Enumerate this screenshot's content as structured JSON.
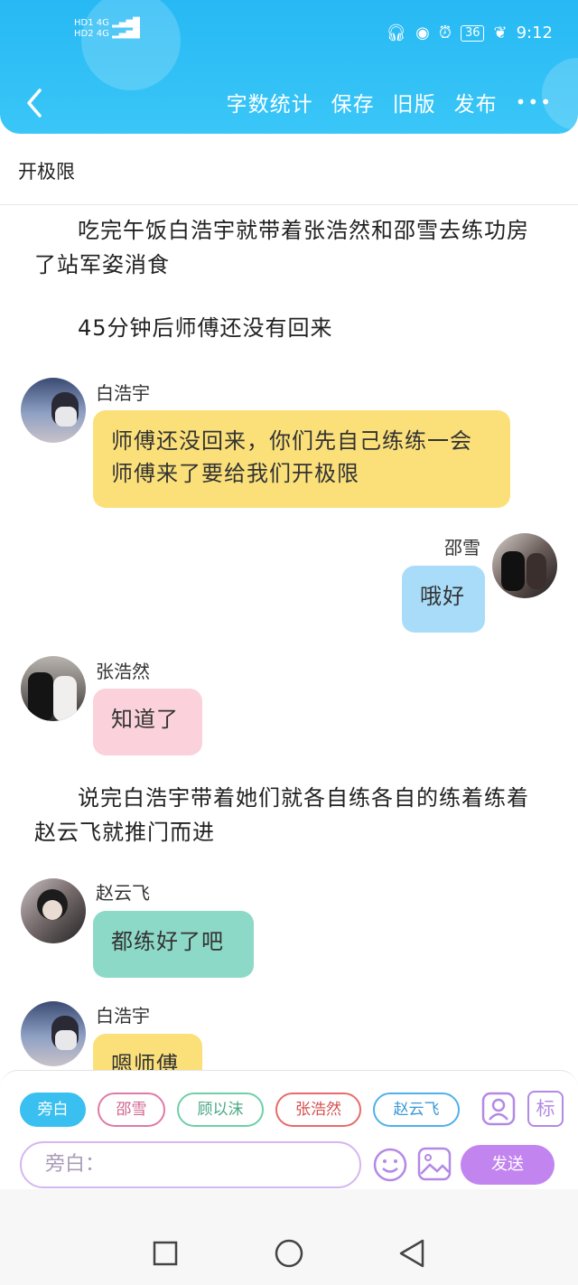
{
  "status": {
    "signal1": "HD1 4G",
    "signal2": "HD2 4G",
    "battery": "36",
    "time": "9:12"
  },
  "toolbar": {
    "word_count": "字数统计",
    "save": "保存",
    "old_version": "旧版",
    "publish": "发布",
    "more": "•••"
  },
  "chapter_title": "开极限",
  "story": [
    {
      "type": "narration",
      "text": "吃完午饭白浩宇就带着张浩然和邵雪去练功房了站军姿消食"
    },
    {
      "type": "narration",
      "text": "45分钟后师傅还没有回来"
    },
    {
      "type": "message",
      "speaker": "白浩宇",
      "side": "left",
      "text": "师傅还没回来，你们先自己练练一会师傅来了要给我们开极限",
      "color": "#fbe07a"
    },
    {
      "type": "message",
      "speaker": "邵雪",
      "side": "right",
      "text": "哦好",
      "color": "#a9dcf8"
    },
    {
      "type": "message",
      "speaker": "张浩然",
      "side": "left",
      "text": "知道了",
      "color": "#fbd2dc"
    },
    {
      "type": "narration",
      "text": "说完白浩宇带着她们就各自练各自的练着练着赵云飞就推门而进"
    },
    {
      "type": "message",
      "speaker": "赵云飞",
      "side": "left",
      "text": "都练好了吧",
      "color": "#8dd9c8"
    },
    {
      "type": "message",
      "speaker": "白浩宇",
      "side": "left",
      "text": "嗯师傅",
      "color": "#fbe07a"
    }
  ],
  "roles": [
    {
      "label": "旁白",
      "active": true,
      "color": "#39c0f0"
    },
    {
      "label": "邵雪",
      "active": false,
      "color": "#e07aa8"
    },
    {
      "label": "顾以沫",
      "active": false,
      "color": "#6fcfa9"
    },
    {
      "label": "张浩然",
      "active": false,
      "color": "#e86b6b"
    },
    {
      "label": "赵云飞",
      "active": false,
      "color": "#4fb0ee"
    }
  ],
  "input": {
    "placeholder": "旁白："
  },
  "send_label": "发送",
  "tag_label": "标"
}
